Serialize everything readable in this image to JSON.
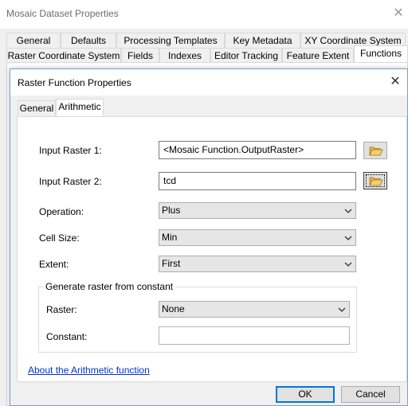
{
  "window": {
    "title": "Mosaic Dataset Properties"
  },
  "outer_tabs_row1": [
    "General",
    "Defaults",
    "Processing Templates",
    "Key Metadata",
    "XY Coordinate System"
  ],
  "outer_tabs_row2": [
    "Raster Coordinate System",
    "Fields",
    "Indexes",
    "Editor Tracking",
    "Feature Extent",
    "Functions"
  ],
  "dialog": {
    "title": "Raster Function Properties",
    "tabs": [
      "General",
      "Arithmetic"
    ],
    "selected_tab": "Arithmetic",
    "input_raster_1": {
      "label": "Input Raster 1:",
      "value": "<Mosaic Function.OutputRaster>"
    },
    "input_raster_2": {
      "label": "Input Raster 2:",
      "value": "tcd"
    },
    "operation": {
      "label": "Operation:",
      "value": "Plus"
    },
    "cell_size": {
      "label": "Cell Size:",
      "value": "Min"
    },
    "extent": {
      "label": "Extent:",
      "value": "First"
    },
    "constant_group": {
      "legend": "Generate raster from constant",
      "raster": {
        "label": "Raster:",
        "value": "None"
      },
      "constant": {
        "label": "Constant:",
        "value": ""
      }
    },
    "help_link": "About the Arithmetic function",
    "ok_label": "OK",
    "cancel_label": "Cancel"
  },
  "icons": {
    "window_close": "close-icon",
    "dialog_close": "close-icon",
    "browse": "open-folder-icon",
    "dropdown": "chevron-down-icon"
  },
  "colors": {
    "accent": "#0078d7",
    "link": "#0033cc",
    "folder": "#e8b84a"
  }
}
